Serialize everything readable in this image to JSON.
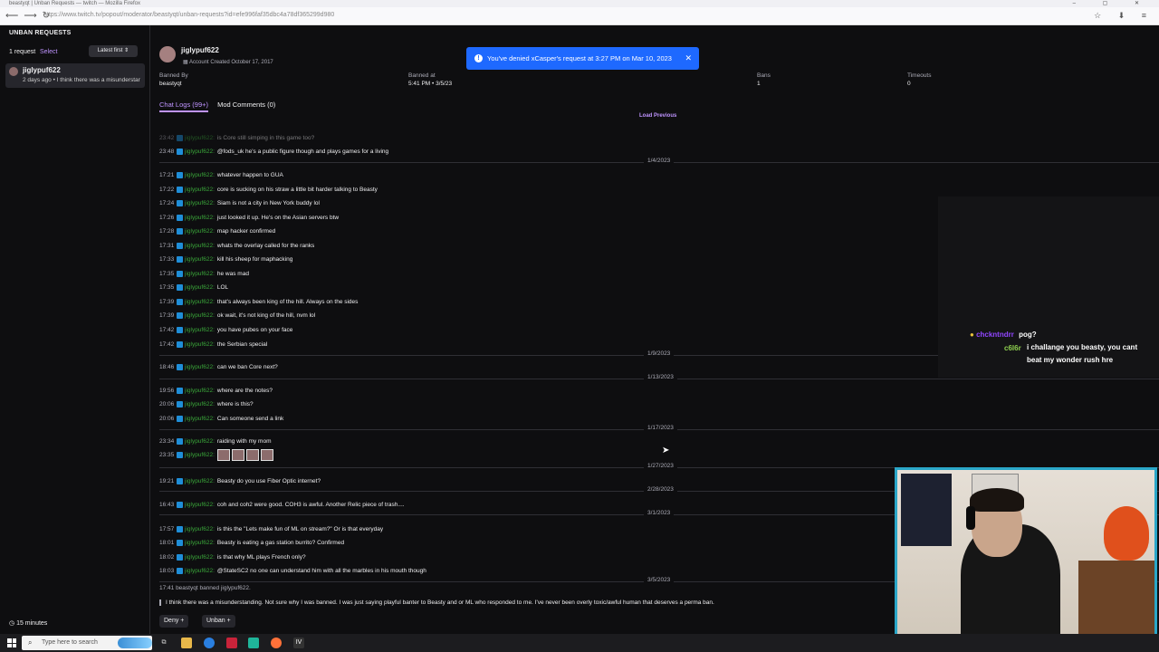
{
  "browser": {
    "window_title": "beastyqt | Unban Requests — twitch — Mozilla Firefox",
    "url": "https://www.twitch.tv/popout/moderator/beastyqt/unban-requests?id=efe996faf35dbc4a78df365299d980"
  },
  "sidebar": {
    "title": "UNBAN REQUESTS",
    "count": "1 request",
    "select_label": "Select",
    "sort_label": "Latest first",
    "item": {
      "name": "jiglypuf622",
      "subtitle": "2 days ago • I think there was a misunderstar"
    },
    "timer": "15 minutes"
  },
  "user": {
    "name": "jiglypuf622",
    "created": "Account Created October 17, 2017",
    "stats": [
      {
        "label": "Banned By",
        "value": "beastyqt"
      },
      {
        "label": "Banned at",
        "value": "5:41 PM • 3/5/23"
      },
      {
        "label": "Bans",
        "value": "1"
      },
      {
        "label": "Timeouts",
        "value": "0"
      }
    ]
  },
  "tabs": {
    "chat_logs": "Chat Logs (99+)",
    "mod_comments": "Mod Comments (0)"
  },
  "load_previous": "Load Previous",
  "toast": "You've denied xCasper's request at 3:27 PM on Mar 10, 2023",
  "chat": [
    {
      "time": "23:42",
      "user": "jiglypuf622:",
      "msg": "is Core still simping in this game too?",
      "faded": true
    },
    {
      "time": "23:48",
      "user": "jiglypuf622:",
      "msg": "@fods_uk he's a public figure though and plays games for a living"
    },
    {
      "date": "1/4/2023"
    },
    {
      "time": "17:21",
      "user": "jiglypuf622:",
      "msg": "whatever happen to GUA"
    },
    {
      "time": "17:22",
      "user": "jiglypuf622:",
      "msg": "core is sucking on his straw a little bit harder talking to Beasty"
    },
    {
      "time": "17:24",
      "user": "jiglypuf622:",
      "msg": "Siam is not a city in New York buddy lol"
    },
    {
      "time": "17:26",
      "user": "jiglypuf622:",
      "msg": "just looked it up. He's on the Asian servers btw"
    },
    {
      "time": "17:28",
      "user": "jiglypuf622:",
      "msg": "map hacker confirmed"
    },
    {
      "time": "17:31",
      "user": "jiglypuf622:",
      "msg": "whats the overlay called for the ranks"
    },
    {
      "time": "17:33",
      "user": "jiglypuf622:",
      "msg": "kill his sheep for maphacking"
    },
    {
      "time": "17:35",
      "user": "jiglypuf622:",
      "msg": "he was mad"
    },
    {
      "time": "17:35",
      "user": "jiglypuf622:",
      "msg": "LOL"
    },
    {
      "time": "17:39",
      "user": "jiglypuf622:",
      "msg": "that's always been king of the hill. Always on the sides"
    },
    {
      "time": "17:39",
      "user": "jiglypuf622:",
      "msg": "ok wait, it's not king of the hill, nvm lol"
    },
    {
      "time": "17:42",
      "user": "jiglypuf622:",
      "msg": "you have pubes on your face"
    },
    {
      "time": "17:42",
      "user": "jiglypuf622:",
      "msg": "the Serbian special"
    },
    {
      "date": "1/9/2023"
    },
    {
      "time": "18:46",
      "user": "jiglypuf622:",
      "msg": "can we ban Core next?"
    },
    {
      "date": "1/13/2023"
    },
    {
      "time": "19:56",
      "user": "jiglypuf622:",
      "msg": "where are the notes?"
    },
    {
      "time": "20:06",
      "user": "jiglypuf622:",
      "msg": "where is this?"
    },
    {
      "time": "20:06",
      "user": "jiglypuf622:",
      "msg": "Can someone send a link"
    },
    {
      "date": "1/17/2023"
    },
    {
      "time": "23:34",
      "user": "jiglypuf622:",
      "msg": "raiding with my mom"
    },
    {
      "time": "23:35",
      "user": "jiglypuf622:",
      "msg": "",
      "emotes": 4
    },
    {
      "date": "1/27/2023"
    },
    {
      "time": "19:21",
      "user": "jiglypuf622:",
      "msg": "Beasty do you use Fiber Optic internet?"
    },
    {
      "date": "2/28/2023"
    },
    {
      "time": "16:43",
      "user": "jiglypuf622:",
      "msg": "coh and coh2 were good. COH3 is awful. Another Relic piece of trash...."
    },
    {
      "date": "3/1/2023"
    },
    {
      "time": "17:57",
      "user": "jiglypuf622:",
      "msg": "is this the \"Lets make fun of ML on stream?\" Or is that everyday"
    },
    {
      "time": "18:01",
      "user": "jiglypuf622:",
      "msg": "Beasty is eating a gas station burrito? Confirmed"
    },
    {
      "time": "18:02",
      "user": "jiglypuf622:",
      "msg": "is that why ML plays French only?"
    },
    {
      "time": "18:03",
      "user": "jiglypuf622:",
      "msg": "@StateSC2 no one can understand him with all the marbles in his mouth though"
    },
    {
      "date": "3/5/2023"
    }
  ],
  "banned_line": "17:41 beastyqt banned jiglypuf622.",
  "reason": "I think there was a misunderstanding. Not sure why I was banned. I was just saying playful banter to Beasty and or ML who responded to me. I've never been overly toxic/awful human that deserves a perma ban.",
  "actions": {
    "deny": "Deny",
    "unban": "Unban"
  },
  "overlay_chat": [
    {
      "user": "chckntndrr",
      "msg": "pog?",
      "color": "#9146ff"
    },
    {
      "user": "c6l6r",
      "msg": "i challange you beasty, you cant beat my wonder rush hre",
      "color": "#8fd14f"
    }
  ],
  "taskbar": {
    "search_placeholder": "Type here to search"
  },
  "colors": {
    "accent": "#bf94ff",
    "toast": "#1e69ff",
    "username": "#3aa63a",
    "webcam_border": "#2aa6c8"
  }
}
